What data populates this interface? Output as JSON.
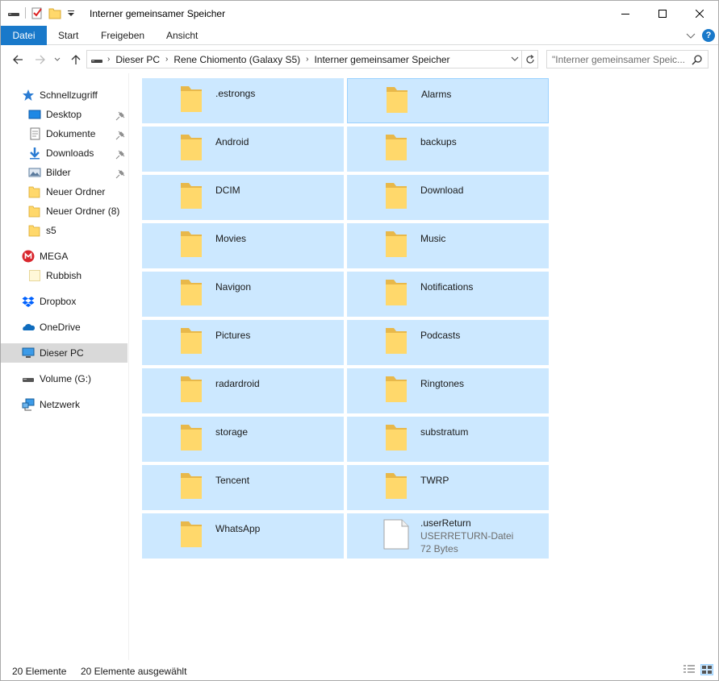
{
  "window": {
    "title": "Interner gemeinsamer Speicher",
    "quick_access_toolbar": [
      "drive-icon",
      "properties-icon",
      "new-folder-icon",
      "customize-dropdown-icon"
    ],
    "controls": [
      "minimize",
      "maximize",
      "close"
    ]
  },
  "ribbon": {
    "tabs": [
      {
        "label": "Datei",
        "active": true
      },
      {
        "label": "Start"
      },
      {
        "label": "Freigeben"
      },
      {
        "label": "Ansicht"
      }
    ]
  },
  "address": {
    "crumbs": [
      "Dieser PC",
      "Rene Chiomento (Galaxy S5)",
      "Interner gemeinsamer Speicher"
    ]
  },
  "search": {
    "placeholder": "\"Interner gemeinsamer Speic..."
  },
  "navpane": {
    "items": [
      {
        "label": "Schnellzugriff",
        "icon": "star-icon",
        "level": 0
      },
      {
        "label": "Desktop",
        "icon": "desktop-icon",
        "level": 1,
        "pinned": true
      },
      {
        "label": "Dokumente",
        "icon": "documents-icon",
        "level": 1,
        "pinned": true
      },
      {
        "label": "Downloads",
        "icon": "downloads-icon",
        "level": 1,
        "pinned": true
      },
      {
        "label": "Bilder",
        "icon": "pictures-icon",
        "level": 1,
        "pinned": true
      },
      {
        "label": "Neuer Ordner",
        "icon": "folder-icon",
        "level": 1
      },
      {
        "label": "Neuer Ordner (8)",
        "icon": "folder-icon",
        "level": 1
      },
      {
        "label": "s5",
        "icon": "folder-icon",
        "level": 1
      },
      {
        "label": "MEGA",
        "icon": "mega-icon",
        "level": 0
      },
      {
        "label": "Rubbish",
        "icon": "folder-icon",
        "level": 1
      },
      {
        "label": "Dropbox",
        "icon": "dropbox-icon",
        "level": 0
      },
      {
        "label": "OneDrive",
        "icon": "onedrive-icon",
        "level": 0
      },
      {
        "label": "Dieser PC",
        "icon": "this-pc-icon",
        "level": 0,
        "selected": true
      },
      {
        "label": "Volume (G:)",
        "icon": "drive-icon",
        "level": 0
      },
      {
        "label": "Netzwerk",
        "icon": "network-icon",
        "level": 0
      }
    ]
  },
  "files": [
    {
      "name": ".estrongs",
      "type": "folder"
    },
    {
      "name": "Alarms",
      "type": "folder",
      "focused": true
    },
    {
      "name": "Android",
      "type": "folder"
    },
    {
      "name": "backups",
      "type": "folder"
    },
    {
      "name": "DCIM",
      "type": "folder"
    },
    {
      "name": "Download",
      "type": "folder"
    },
    {
      "name": "Movies",
      "type": "folder"
    },
    {
      "name": "Music",
      "type": "folder"
    },
    {
      "name": "Navigon",
      "type": "folder"
    },
    {
      "name": "Notifications",
      "type": "folder"
    },
    {
      "name": "Pictures",
      "type": "folder"
    },
    {
      "name": "Podcasts",
      "type": "folder"
    },
    {
      "name": "radardroid",
      "type": "folder"
    },
    {
      "name": "Ringtones",
      "type": "folder"
    },
    {
      "name": "storage",
      "type": "folder"
    },
    {
      "name": "substratum",
      "type": "folder"
    },
    {
      "name": "Tencent",
      "type": "folder"
    },
    {
      "name": "TWRP",
      "type": "folder"
    },
    {
      "name": "WhatsApp",
      "type": "folder"
    },
    {
      "name": ".userReturn",
      "type": "file",
      "file_type": "USERRETURN-Datei",
      "size": "72 Bytes"
    }
  ],
  "status": {
    "count": "20 Elemente",
    "selected": "20 Elemente ausgewählt"
  },
  "colors": {
    "accent": "#1979ca",
    "selection": "#cce8ff",
    "selection_border": "#99d1ff",
    "folder": "#ffd86b"
  }
}
